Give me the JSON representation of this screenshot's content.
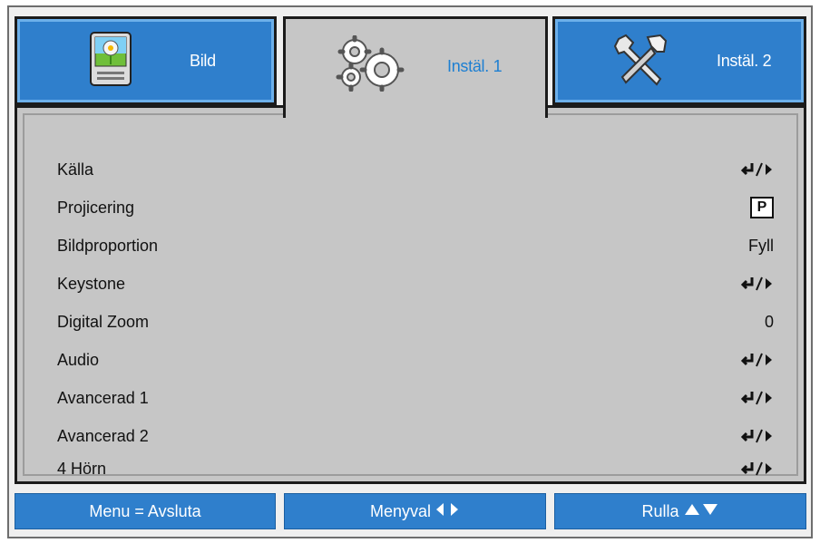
{
  "tabs": [
    {
      "label": "Bild",
      "icon": "picture-settings-icon",
      "active": false
    },
    {
      "label": "Instäl. 1",
      "icon": "gears-icon",
      "active": true
    },
    {
      "label": "Instäl. 2",
      "icon": "tools-icon",
      "active": false
    }
  ],
  "menu": {
    "items": [
      {
        "label": "Källa",
        "value_type": "enter-arrow"
      },
      {
        "label": "Projicering",
        "value_type": "p-box",
        "value": "P"
      },
      {
        "label": "Bildproportion",
        "value_type": "text",
        "value": "Fyll"
      },
      {
        "label": "Keystone",
        "value_type": "enter-arrow"
      },
      {
        "label": "Digital Zoom",
        "value_type": "text",
        "value": "0"
      },
      {
        "label": "Audio",
        "value_type": "enter-arrow"
      },
      {
        "label": "Avancerad 1",
        "value_type": "enter-arrow"
      },
      {
        "label": "Avancerad 2",
        "value_type": "enter-arrow"
      },
      {
        "label": "4 Hörn",
        "value_type": "enter-arrow"
      }
    ]
  },
  "bottom_bar": {
    "menu_exit": "Menu = Avsluta",
    "menyval": "Menyval",
    "rulla": "Rulla"
  },
  "colors": {
    "tab_blue": "#2f7fcc",
    "panel_gray": "#c6c6c6",
    "active_text": "#1d7fd2"
  }
}
